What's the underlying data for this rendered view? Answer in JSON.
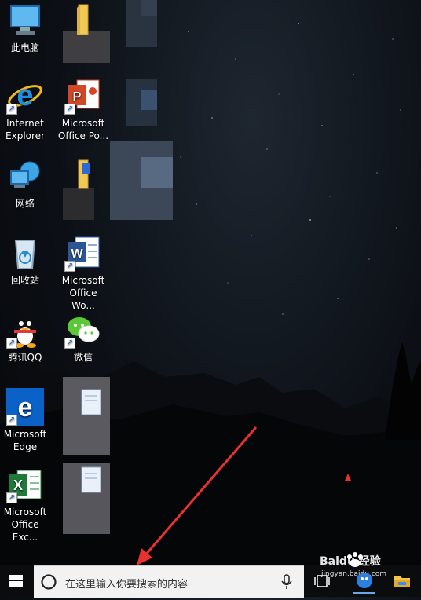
{
  "desktop": {
    "icons": [
      {
        "label": "此电脑"
      },
      {
        "label": "Internet\nExplorer"
      },
      {
        "label": "网络"
      },
      {
        "label": "回收站"
      },
      {
        "label": "腾讯QQ"
      },
      {
        "label": "Microsoft\nEdge"
      },
      {
        "label": "Microsoft\nOffice Exc..."
      },
      {
        "label": "Microsoft\nOffice Po..."
      },
      {
        "label": "Microsoft\nOffice Wo..."
      },
      {
        "label": "微信"
      }
    ]
  },
  "taskbar": {
    "search_placeholder": "在这里输入你要搜索的内容",
    "watermark": "Baidu 经验",
    "watermark_sub": "jingyan.baidu.com"
  },
  "colors": {
    "arrow": "#e8322f",
    "taskbar": "#0b0c0e",
    "search_bg": "#f2f2f2",
    "edge_blue": "#0a62c9",
    "excel_green": "#1f7a3a"
  }
}
